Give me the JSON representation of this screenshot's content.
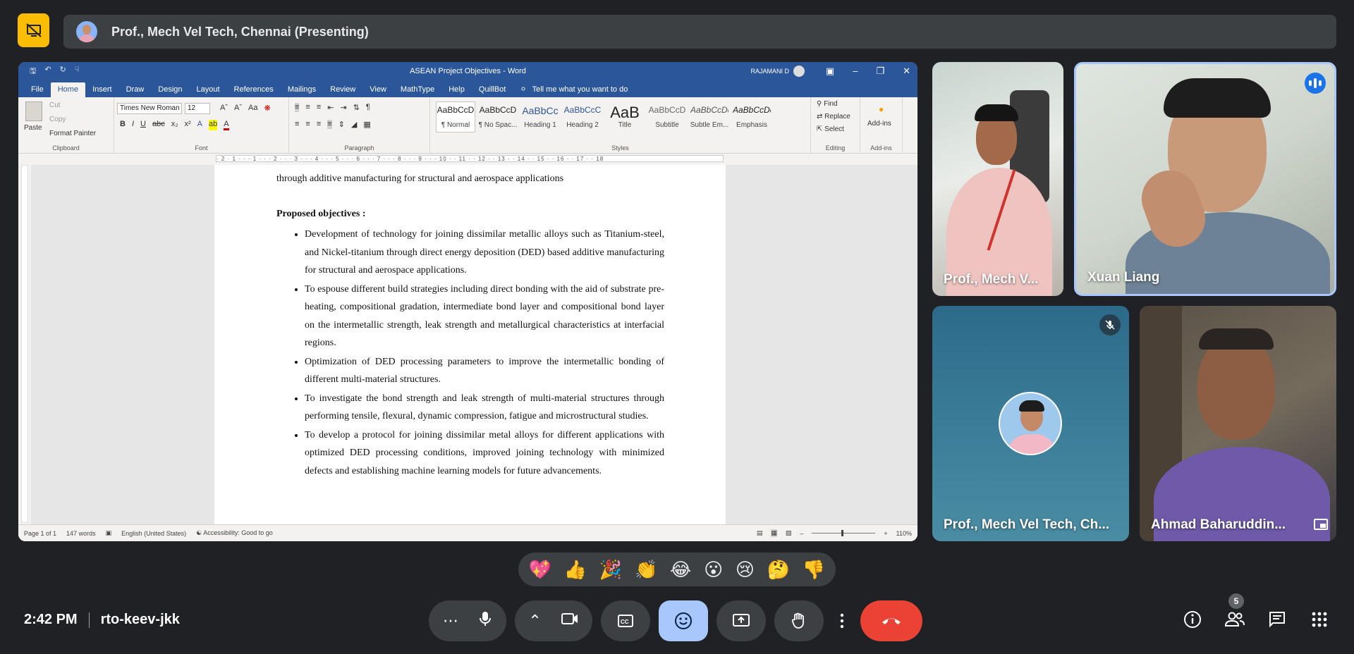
{
  "presenting": {
    "label": "Prof., Mech Vel Tech, Chennai (Presenting)"
  },
  "word": {
    "title": "ASEAN Project Objectives  -  Word",
    "user": "RAJAMANI D",
    "tabs": [
      "File",
      "Home",
      "Insert",
      "Draw",
      "Design",
      "Layout",
      "References",
      "Mailings",
      "Review",
      "View",
      "MathType",
      "Help",
      "QuillBot"
    ],
    "tell_me": "Tell me what you want to do",
    "clipboard": {
      "paste": "Paste",
      "cut": "Cut",
      "copy": "Copy",
      "format_painter": "Format Painter",
      "label": "Clipboard"
    },
    "font": {
      "name": "Times New Roman",
      "size": "12",
      "label": "Font"
    },
    "paragraph_label": "Paragraph",
    "styles": [
      {
        "preview": "AaBbCcD",
        "name": "¶ Normal"
      },
      {
        "preview": "AaBbCcD",
        "name": "¶ No Spac..."
      },
      {
        "preview": "AaBbCc",
        "name": "Heading 1"
      },
      {
        "preview": "AaBbCcC",
        "name": "Heading 2"
      },
      {
        "preview": "AaB",
        "name": "Title"
      },
      {
        "preview": "AaBbCcD",
        "name": "Subtitle"
      },
      {
        "preview": "AaBbCcDd",
        "name": "Subtle Em..."
      },
      {
        "preview": "AaBbCcDd",
        "name": "Emphasis"
      }
    ],
    "styles_label": "Styles",
    "editing": {
      "find": "Find",
      "replace": "Replace",
      "select": "Select",
      "label": "Editing"
    },
    "addins": {
      "button": "Add-ins",
      "label": "Add-ins"
    },
    "document": {
      "first_line": "through additive manufacturing for structural and aerospace applications",
      "heading": "Proposed objectives  :",
      "bullets": [
        "Development of technology for joining dissimilar metallic alloys such as Titanium-steel, and Nickel-titanium through direct energy deposition (DED) based additive manufacturing for structural and aerospace applications.",
        "To espouse different build strategies including direct bonding with the aid of substrate pre-heating, compositional gradation, intermediate bond layer and compositional bond layer on the intermetallic strength, leak strength and metallurgical characteristics at interfacial regions.",
        "Optimization of DED processing parameters to improve the intermetallic bonding of different multi-material structures.",
        "To investigate the bond strength and leak strength of multi-material structures through performing tensile, flexural, dynamic compression, fatigue and microstructural studies.",
        "To develop a protocol for joining dissimilar metal alloys for different applications with optimized DED processing conditions, improved joining technology with minimized defects and establishing machine learning models for future advancements."
      ]
    },
    "status": {
      "page": "Page 1 of 1",
      "words": "147 words",
      "language": "English (United States)",
      "accessibility": "Accessibility: Good to go",
      "zoom": "110%"
    }
  },
  "participants": [
    {
      "name": "Prof., Mech V...",
      "speaking": false,
      "muted": false
    },
    {
      "name": "Xuan Liang",
      "speaking": true,
      "muted": false
    },
    {
      "name": "Prof., Mech Vel Tech, Ch...",
      "speaking": false,
      "muted": true
    },
    {
      "name": "Ahmad Baharuddin...",
      "speaking": false,
      "muted": false
    }
  ],
  "reactions": [
    "💖",
    "👍",
    "🎉",
    "👏",
    "😂",
    "😮",
    "😢",
    "🤔",
    "👎"
  ],
  "meeting": {
    "time": "2:42 PM",
    "code": "rto-keev-jkk",
    "participant_count": "5"
  },
  "colors": {
    "accent": "#a8c7fa",
    "end_call": "#ea4335",
    "word_blue": "#2b579a",
    "presenting_icon": "#fbbc04"
  }
}
